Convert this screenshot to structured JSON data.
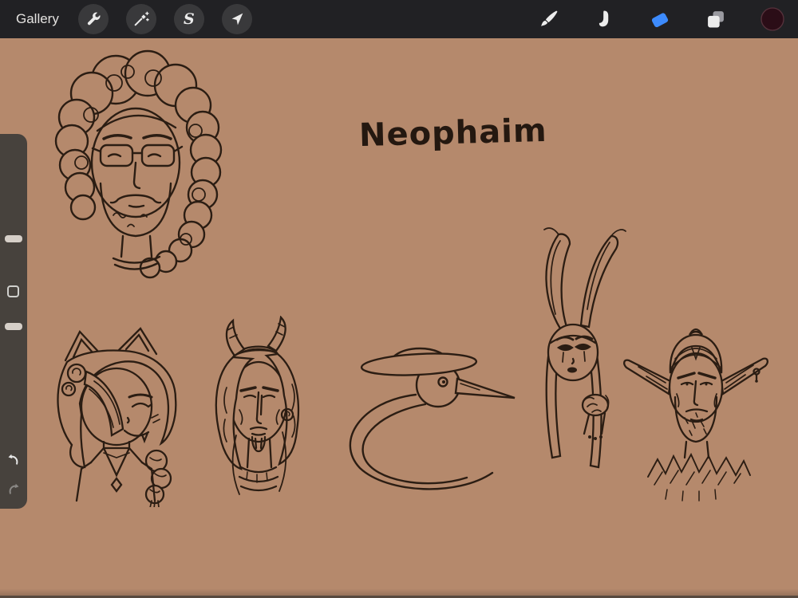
{
  "topbar": {
    "gallery_label": "Gallery",
    "selection_glyph": "S",
    "left_tools": [
      {
        "id": "actions",
        "icon": "wrench-icon"
      },
      {
        "id": "adjustments",
        "icon": "magic-wand-icon"
      },
      {
        "id": "selection",
        "icon": "selection-s-icon"
      },
      {
        "id": "transform",
        "icon": "transform-arrow-icon"
      }
    ],
    "right_tools": [
      {
        "id": "paint",
        "icon": "paintbrush-icon"
      },
      {
        "id": "smudge",
        "icon": "smudge-finger-icon"
      },
      {
        "id": "erase",
        "icon": "eraser-icon",
        "active": true
      },
      {
        "id": "layers",
        "icon": "layers-icon"
      },
      {
        "id": "color",
        "icon": "color-swatch",
        "value": "#2b0d17"
      }
    ],
    "active_tool": "erase"
  },
  "sidebar": {
    "controls": [
      "brush-size-slider",
      "modify-button",
      "opacity-slider",
      "undo-button",
      "redo-button"
    ]
  },
  "canvas": {
    "background_color": "#b5896c",
    "ink_color": "#2b1d13",
    "title_text": "Neophaim",
    "sketches": [
      "curly-haired-man-portrait",
      "cat-eared-girl",
      "horned-man",
      "heron-wearing-hat",
      "rabbit-eared-viera",
      "elf-man"
    ]
  },
  "colors": {
    "topbar_bg": "#212124",
    "icon_button_bg": "#39393b",
    "accent_blue": "#3d8bfd",
    "sidebar_bg": "#3e3c3a",
    "slider_handle": "#d6cfc8"
  }
}
